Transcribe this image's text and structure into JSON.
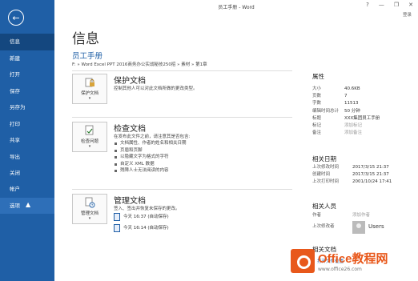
{
  "window": {
    "title": "员工手册 - Word",
    "help": "?",
    "minimize": "—",
    "restore": "❐",
    "close": "✕",
    "signin": "登录"
  },
  "sidebar": {
    "back": "←",
    "items": [
      {
        "label": "信息"
      },
      {
        "label": "新建"
      },
      {
        "label": "打开"
      },
      {
        "label": "保存"
      },
      {
        "label": "另存为"
      },
      {
        "label": "打印"
      },
      {
        "label": "共享"
      },
      {
        "label": "导出"
      },
      {
        "label": "关闭"
      }
    ],
    "bottom_items": [
      {
        "label": "帐户"
      },
      {
        "label": "选项"
      }
    ]
  },
  "main": {
    "title": "信息",
    "doc_name": "员工手册",
    "path": "F: » Word Excel PPT 2016商务办公实战秘技250招 » 素材 » 第1章",
    "protect": {
      "button_label": "保护文档",
      "heading": "保护文档",
      "desc": "控制其他人可以对此文档所做的更改类型。"
    },
    "inspect": {
      "button_label": "检查问题",
      "heading": "检查文档",
      "desc": "在发布此文件之前，请注意其是否包含:",
      "bullets": [
        "文档属性、作者的姓名和相关日期",
        "页眉和页脚",
        "以隐藏文字为格式的字符",
        "自定义 XML 数据",
        "残障人士无法阅读的内容"
      ]
    },
    "manage": {
      "button_label": "管理文档",
      "heading": "管理文档",
      "desc": "签入、签出并恢复未保存的更改。",
      "versions": [
        "今天 16:37 (自动保存)",
        "今天 16:14 (自动保存)"
      ]
    }
  },
  "props": {
    "heading": "属性",
    "rows": [
      {
        "k": "大小",
        "v": "40.6KB"
      },
      {
        "k": "页数",
        "v": "7"
      },
      {
        "k": "字数",
        "v": "11513"
      },
      {
        "k": "编辑时间总计",
        "v": "50 分钟"
      },
      {
        "k": "标题",
        "v": "XXX集团员工手册"
      },
      {
        "k": "标记",
        "v": "添加标记"
      },
      {
        "k": "备注",
        "v": "添加备注"
      }
    ],
    "dates_heading": "相关日期",
    "dates": [
      {
        "k": "上次修改时间",
        "v": "2017/3/15 21:37"
      },
      {
        "k": "创建时间",
        "v": "2017/3/15 21:37"
      },
      {
        "k": "上次打印时间",
        "v": "2001/10/24 17:41"
      }
    ],
    "people_heading": "相关人员",
    "author_label": "作者",
    "author_add": "添加作者",
    "modified_by_label": "上次修改者",
    "modified_by": "Users",
    "related_heading": "相关文档",
    "related_link": "打开文件位置"
  },
  "watermark": {
    "main": "Office教程网",
    "sub": "www.office26.com"
  }
}
